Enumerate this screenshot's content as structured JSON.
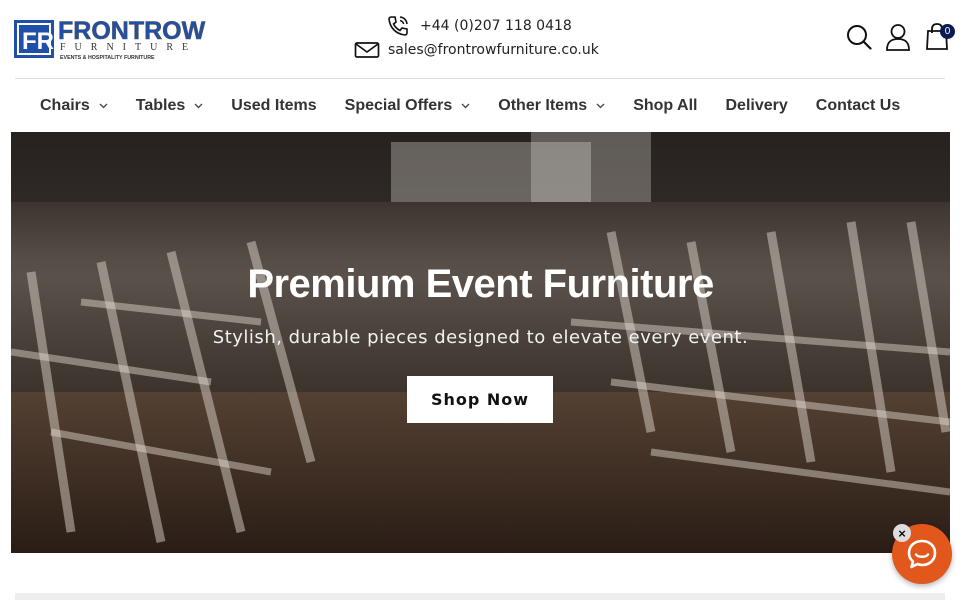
{
  "header": {
    "logo_text": "FRONTROW",
    "logo_sub": "FURNITURE",
    "logo_tagline": "EVENTS & HOSPITALITY FURNITURE",
    "phone": "+44 (0)207 118 0418",
    "email": "sales@frontrowfurniture.co.uk",
    "cart_count": "0"
  },
  "nav": {
    "items": [
      {
        "label": "Chairs",
        "dropdown": true
      },
      {
        "label": "Tables",
        "dropdown": true
      },
      {
        "label": "Used Items",
        "dropdown": false
      },
      {
        "label": "Special Offers",
        "dropdown": true
      },
      {
        "label": "Other Items",
        "dropdown": true
      },
      {
        "label": "Shop All",
        "dropdown": false
      },
      {
        "label": "Delivery",
        "dropdown": false
      },
      {
        "label": "Contact Us",
        "dropdown": false
      }
    ]
  },
  "hero": {
    "title": "Premium Event Furniture",
    "subtitle": "Stylish, durable pieces designed to elevate every event.",
    "button_label": "Shop Now"
  },
  "chat": {
    "close_label": "×"
  },
  "colors": {
    "brand_blue": "#1f4fa8",
    "cart_badge": "#0b1a55",
    "chat_orange": "#e2571c"
  }
}
